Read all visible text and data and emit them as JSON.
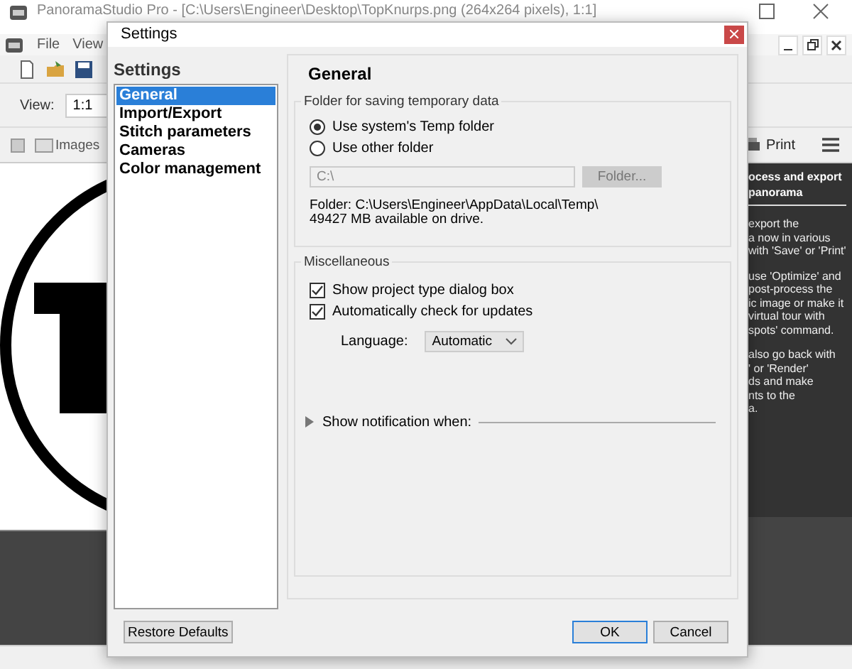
{
  "app": {
    "title": "PanoramaStudio Pro - [C:\\Users\\Engineer\\Desktop\\TopKnurps.png (264x264 pixels), 1:1]",
    "menu": [
      "File",
      "View"
    ],
    "view_label": "View:",
    "zoom": "1:1",
    "images_label": "Images",
    "print_label": "Print",
    "side_panel": {
      "heading": [
        "ocess and export",
        "panorama"
      ],
      "paragraphs": [
        [
          "export the",
          "a now in various",
          "with 'Save' or 'Print'"
        ],
        [
          "use 'Optimize' and",
          "post-process the",
          "ic image or make it",
          "virtual tour with",
          "spots' command."
        ],
        [
          "also go back with",
          "' or 'Render'",
          "ds and make",
          "nts to the",
          "a."
        ]
      ]
    }
  },
  "dialog": {
    "title": "Settings",
    "sidebar_title": "Settings",
    "nav": [
      {
        "label": "General",
        "selected": true
      },
      {
        "label": "Import/Export",
        "selected": false
      },
      {
        "label": "Stitch parameters",
        "selected": false
      },
      {
        "label": "Cameras",
        "selected": false
      },
      {
        "label": "Color management",
        "selected": false
      }
    ],
    "page_title": "General",
    "temp_group": {
      "legend": "Folder for saving temporary data",
      "options": [
        {
          "label": "Use system's Temp folder",
          "selected": true
        },
        {
          "label": "Use other folder",
          "selected": false
        }
      ],
      "folder_path": {
        "value": "C:\\",
        "disabled": true
      },
      "folder_button": {
        "label": "Folder...",
        "disabled": true
      },
      "info": [
        "Folder: C:\\Users\\Engineer\\AppData\\Local\\Temp\\",
        "49427 MB available on drive."
      ]
    },
    "misc_group": {
      "legend": "Miscellaneous",
      "checks": [
        {
          "label": "Show project type dialog box",
          "checked": true
        },
        {
          "label": "Automatically check for updates",
          "checked": true
        }
      ],
      "language_label": "Language:",
      "language": "Automatic",
      "notification": {
        "label": "Show notification when:",
        "expanded": false
      }
    },
    "restore_button": "Restore Defaults",
    "buttons": [
      {
        "label": "OK",
        "default": true
      },
      {
        "label": "Cancel",
        "default": false
      }
    ]
  }
}
